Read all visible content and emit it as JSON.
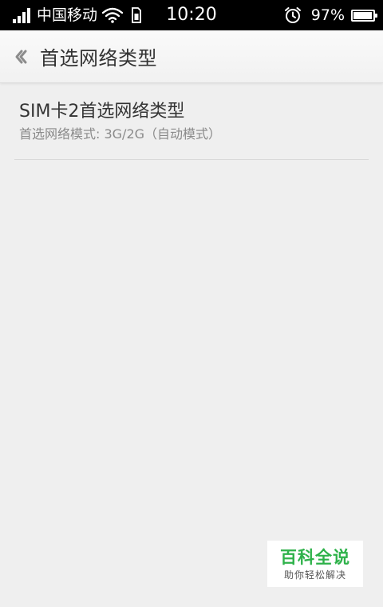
{
  "status_bar": {
    "carrier": "中国移动",
    "time": "10:20",
    "battery_percent_text": "97%",
    "battery_level": 0.97,
    "icons": [
      "signal-icon",
      "wifi-icon",
      "sim-icon",
      "alarm-icon",
      "battery-icon"
    ]
  },
  "header": {
    "back_icon": "chevron-left-icon",
    "title": "首选网络类型"
  },
  "list": {
    "items": [
      {
        "title": "SIM卡2首选网络类型",
        "subtitle": "首选网络模式: 3G/2G（自动模式）"
      }
    ]
  },
  "watermark": {
    "main": "百科全说",
    "sub": "助你轻松解决"
  },
  "colors": {
    "background": "#efefef",
    "status_bar": "#000000",
    "title_text": "#333333",
    "subtitle_text": "#8a8a8a",
    "watermark_green": "#2eb24a"
  }
}
